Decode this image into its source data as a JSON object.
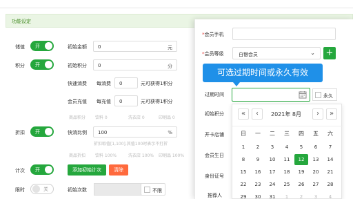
{
  "section": {
    "title": "功能设定"
  },
  "left": {
    "stored_value": {
      "label": "储值",
      "toggle": "开",
      "opening_amount_label": "初始金额",
      "opening_amount": "0",
      "unit": "元"
    },
    "points": {
      "label": "积分",
      "toggle": "开",
      "opening_points_label": "初始积分",
      "opening_points": "0",
      "unit": "分",
      "quick_consume_label": "快速消费",
      "per_consume_prefix": "每消费",
      "per_consume_value": "0",
      "per_consume_suffix": "元可获得1积分",
      "recharge_label": "会员充值",
      "per_recharge_prefix": "每充值",
      "per_recharge_value": "0",
      "per_recharge_suffix": "元可获得1积分",
      "hint_row": [
        "商品积分",
        "饮料 0",
        "洗衣店 0",
        "印刷品 0"
      ]
    },
    "discount": {
      "label": "折扣",
      "toggle": "开",
      "quick_ratio_label": "快消比例",
      "quick_ratio": "100",
      "unit": "%",
      "ratio_hint": "折扣取值[1,100],其值100时表示不打折",
      "hint_row": [
        "商品折扣",
        "饮料 100%",
        "洗衣店 100%",
        "印刷品 100%"
      ]
    },
    "count": {
      "label": "计次",
      "toggle": "开",
      "add_button": "添加初始计次",
      "clear_button": "清除"
    },
    "limited": {
      "label": "限时",
      "toggle": "关",
      "initial_count_label": "初始次数",
      "unlimited_label": "不限"
    }
  },
  "panel": {
    "phone_label": "会员手机",
    "level_label": "会员等级",
    "level_value": "白银会员",
    "add_icon": "plus-icon",
    "expire_label": "过期时间",
    "permanent_label": "永久",
    "opening_points_label": "初始积分",
    "opening_store_label": "开卡店铺",
    "birthday_label": "会员生日",
    "id_label": "身份证号",
    "referrer_label": "推荐人"
  },
  "tooltip": {
    "text": "可选过期时间或永久有效"
  },
  "calendar": {
    "title": "2021年 8月",
    "weekdays": [
      "日",
      "一",
      "二",
      "三",
      "四",
      "五",
      "六"
    ],
    "rows": [
      [
        "1",
        "2",
        "3",
        "4",
        "5",
        "6",
        "7"
      ],
      [
        "8",
        "9",
        "10",
        "11",
        "12",
        "13",
        "14"
      ],
      [
        "15",
        "16",
        "17",
        "18",
        "19",
        "20",
        "21"
      ],
      [
        "22",
        "23",
        "24",
        "25",
        "26",
        "27",
        "28"
      ],
      [
        "29",
        "30",
        "31",
        "1",
        "2",
        "3",
        "4"
      ]
    ],
    "selected": "12",
    "accent": "#25a73d"
  },
  "colors": {
    "green": "#25a73d",
    "orange": "#ff6a3d",
    "tooltip_blue": "#1f90e8"
  }
}
